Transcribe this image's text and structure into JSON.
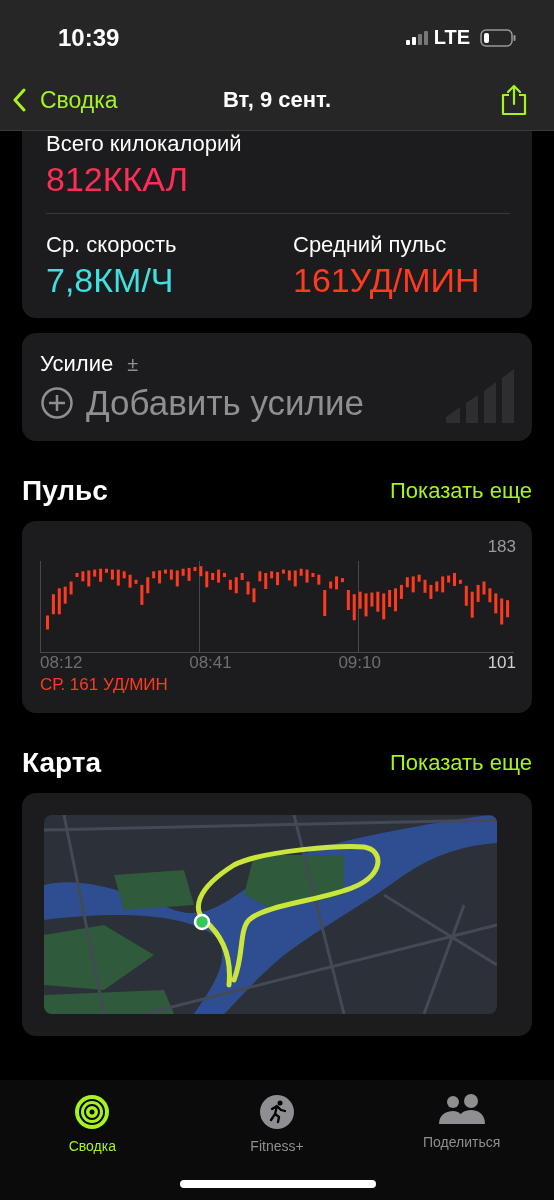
{
  "status_bar": {
    "time": "10:39",
    "network": "LTE"
  },
  "nav": {
    "back": "Сводка",
    "title": "Вт, 9 сент."
  },
  "summary": [
    {
      "label": "Всего килокалорий",
      "value": "812ККАЛ",
      "color": "#ff2d55"
    },
    {
      "label": "Ср. скорость",
      "value": "7,8КМ/Ч",
      "color": "#40e0e0"
    },
    {
      "label": "Средний пульс",
      "value": "161УД/МИН",
      "color": "#ff3b1f"
    }
  ],
  "effort": {
    "label": "Усилие",
    "sign": "±",
    "action": "Добавить усилие"
  },
  "pulse": {
    "title": "Пульс",
    "more": "Показать еще",
    "max": "183",
    "min": "101",
    "times": [
      "08:12",
      "08:41",
      "09:10"
    ],
    "average": "СР. 161 УД/МИН"
  },
  "map": {
    "title": "Карта",
    "more": "Показать еще",
    "kind": "picture"
  },
  "tabs": [
    {
      "label": "Сводка",
      "selected": true
    },
    {
      "label": "Fitness+",
      "selected": false
    },
    {
      "label": "Поделиться",
      "selected": false
    }
  ]
}
